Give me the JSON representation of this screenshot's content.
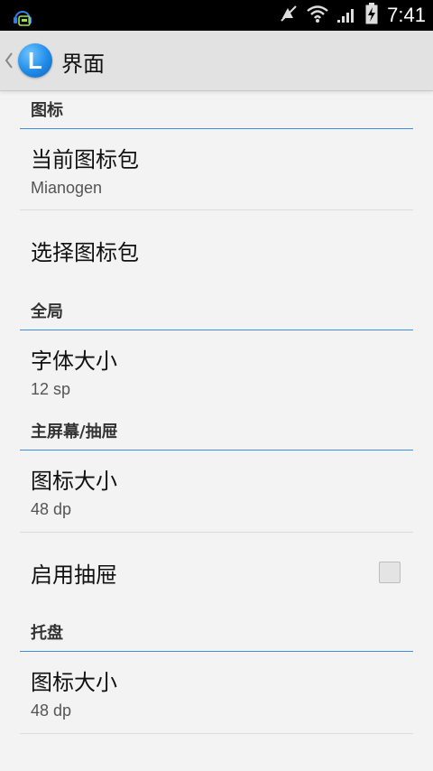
{
  "status_bar": {
    "time": "7:41",
    "icons": [
      "notification-icon",
      "muted-icon",
      "wifi-icon",
      "signal-icon",
      "battery-charging-icon"
    ]
  },
  "action_bar": {
    "logo_letter": "L",
    "title": "界面"
  },
  "sections": {
    "icons": {
      "header": "图标",
      "current_pack": {
        "title": "当前图标包",
        "value": "Mianogen"
      },
      "choose_pack": {
        "title": "选择图标包"
      }
    },
    "global": {
      "header": "全局",
      "font_size": {
        "title": "字体大小",
        "value": "12 sp"
      }
    },
    "homescreen": {
      "header": "主屏幕/抽屉",
      "icon_size": {
        "title": "图标大小",
        "value": "48 dp"
      },
      "enable_drawer": {
        "title": "启用抽屉",
        "checked": false
      }
    },
    "tray": {
      "header": "托盘",
      "icon_size": {
        "title": "图标大小",
        "value": "48 dp"
      }
    }
  },
  "colors": {
    "accent": "#3d8fe0",
    "status_bar": "#000000",
    "action_bar": "#e2e2e2",
    "background": "#f3f3f3"
  }
}
